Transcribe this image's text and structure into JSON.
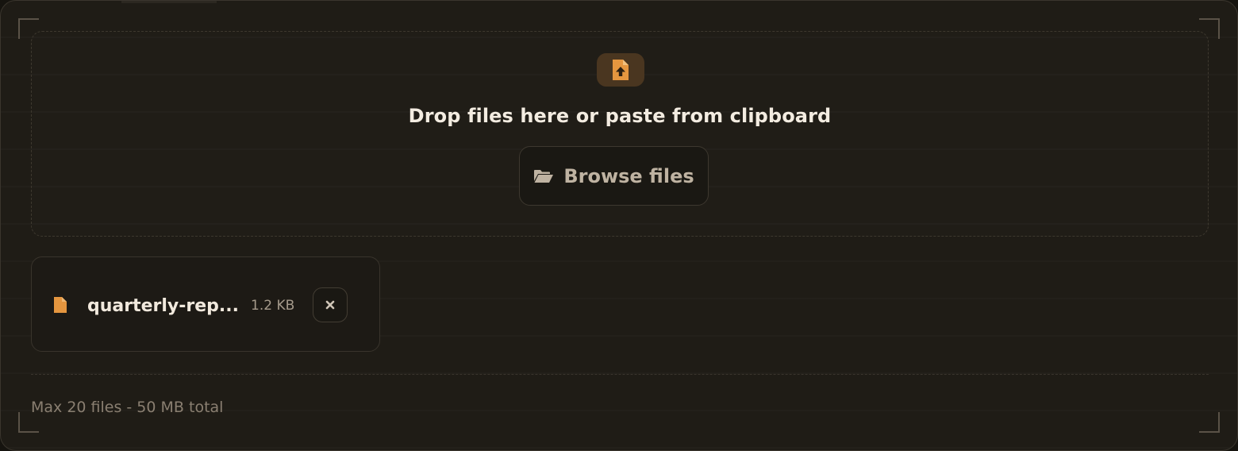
{
  "dropzone": {
    "title": "Drop files here or paste from clipboard",
    "icon": "file-upload-icon",
    "browse_label": "Browse files",
    "browse_icon": "folder-open-icon"
  },
  "files": [
    {
      "name": "quarterly-rep...",
      "size": "1.2 KB",
      "icon": "file-icon",
      "remove_icon": "close-icon"
    }
  ],
  "footer": {
    "limits": "Max 20 files - 50 MB total"
  },
  "colors": {
    "accent": "#e5963f",
    "background": "#1f1c16",
    "text_primary": "#f3ece1",
    "text_muted": "#8a7f71"
  }
}
